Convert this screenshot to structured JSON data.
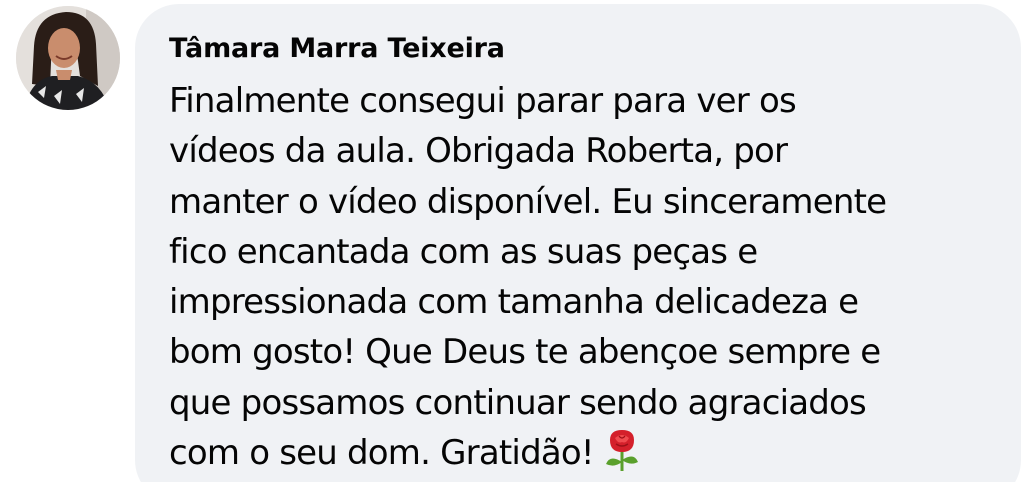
{
  "comment": {
    "author_name": "Tâmara Marra Teixeira",
    "avatar_icon": "profile-photo",
    "text_lines": [
      "Finalmente consegui parar para ver os",
      "vídeos da aula. Obrigada Roberta, por",
      "manter o vídeo disponível. Eu sinceramente",
      "fico encantada com as suas peças e",
      "impressionada com tamanha delicadeza e",
      "bom gosto! Que Deus te abençoe sempre e",
      "que possamos continuar sendo agraciados",
      "com o seu dom. Gratidão!"
    ],
    "emoji_icon": "rose-icon"
  },
  "colors": {
    "bubble_background": "#f0f2f5",
    "text": "#050505",
    "rose": "#d4202b",
    "leaf": "#5aa02c"
  }
}
